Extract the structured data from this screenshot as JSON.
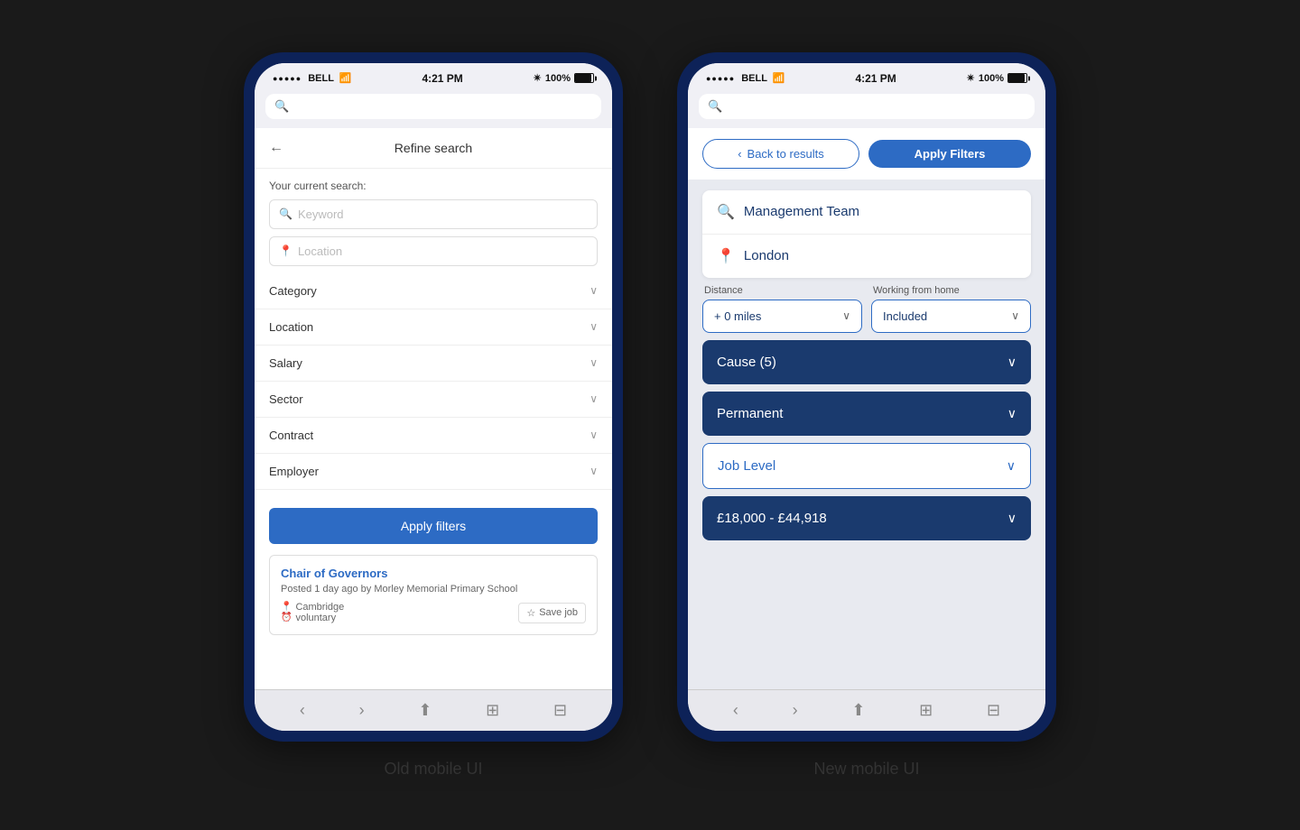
{
  "page": {
    "background": "#1a1a1a"
  },
  "old_ui": {
    "label": "Old mobile UI",
    "status_bar": {
      "signal": "●●●●●",
      "carrier": "BELL",
      "time": "4:21 PM",
      "battery": "100%"
    },
    "header": {
      "back_label": "←",
      "title": "Refine search"
    },
    "current_search_label": "Your current search:",
    "keyword_placeholder": "Keyword",
    "location_placeholder": "Location",
    "filters": [
      {
        "label": "Category"
      },
      {
        "label": "Location"
      },
      {
        "label": "Salary"
      },
      {
        "label": "Sector"
      },
      {
        "label": "Contract"
      },
      {
        "label": "Employer"
      }
    ],
    "apply_btn": "Apply filters",
    "job_card": {
      "title": "Chair of Governors",
      "posted": "Posted 1 day ago by Morley Memorial Primary School",
      "location": "Cambridge",
      "type": "voluntary",
      "save_label": "Save job"
    },
    "browser_nav": [
      "‹",
      "›",
      "⬆",
      "⊞",
      "⊟"
    ]
  },
  "new_ui": {
    "label": "New mobile UI",
    "status_bar": {
      "signal": "●●●●●",
      "carrier": "BELL",
      "time": "4:21 PM",
      "battery": "100%"
    },
    "header": {
      "back_btn": "Back to results",
      "apply_btn": "Apply Filters"
    },
    "search_input": "Management Team",
    "location_input": "London",
    "distance": {
      "label": "Distance",
      "value": "+ 0 miles"
    },
    "working_from_home": {
      "label": "Working from home",
      "value": "Included"
    },
    "filters": [
      {
        "label": "Cause (5)",
        "style": "filled"
      },
      {
        "label": "Permanent",
        "style": "filled"
      },
      {
        "label": "Job Level",
        "style": "outline"
      },
      {
        "label": "£18,000  -  £44,918",
        "style": "filled"
      }
    ],
    "browser_nav": [
      "‹",
      "›",
      "⬆",
      "⊞",
      "⊟"
    ]
  }
}
